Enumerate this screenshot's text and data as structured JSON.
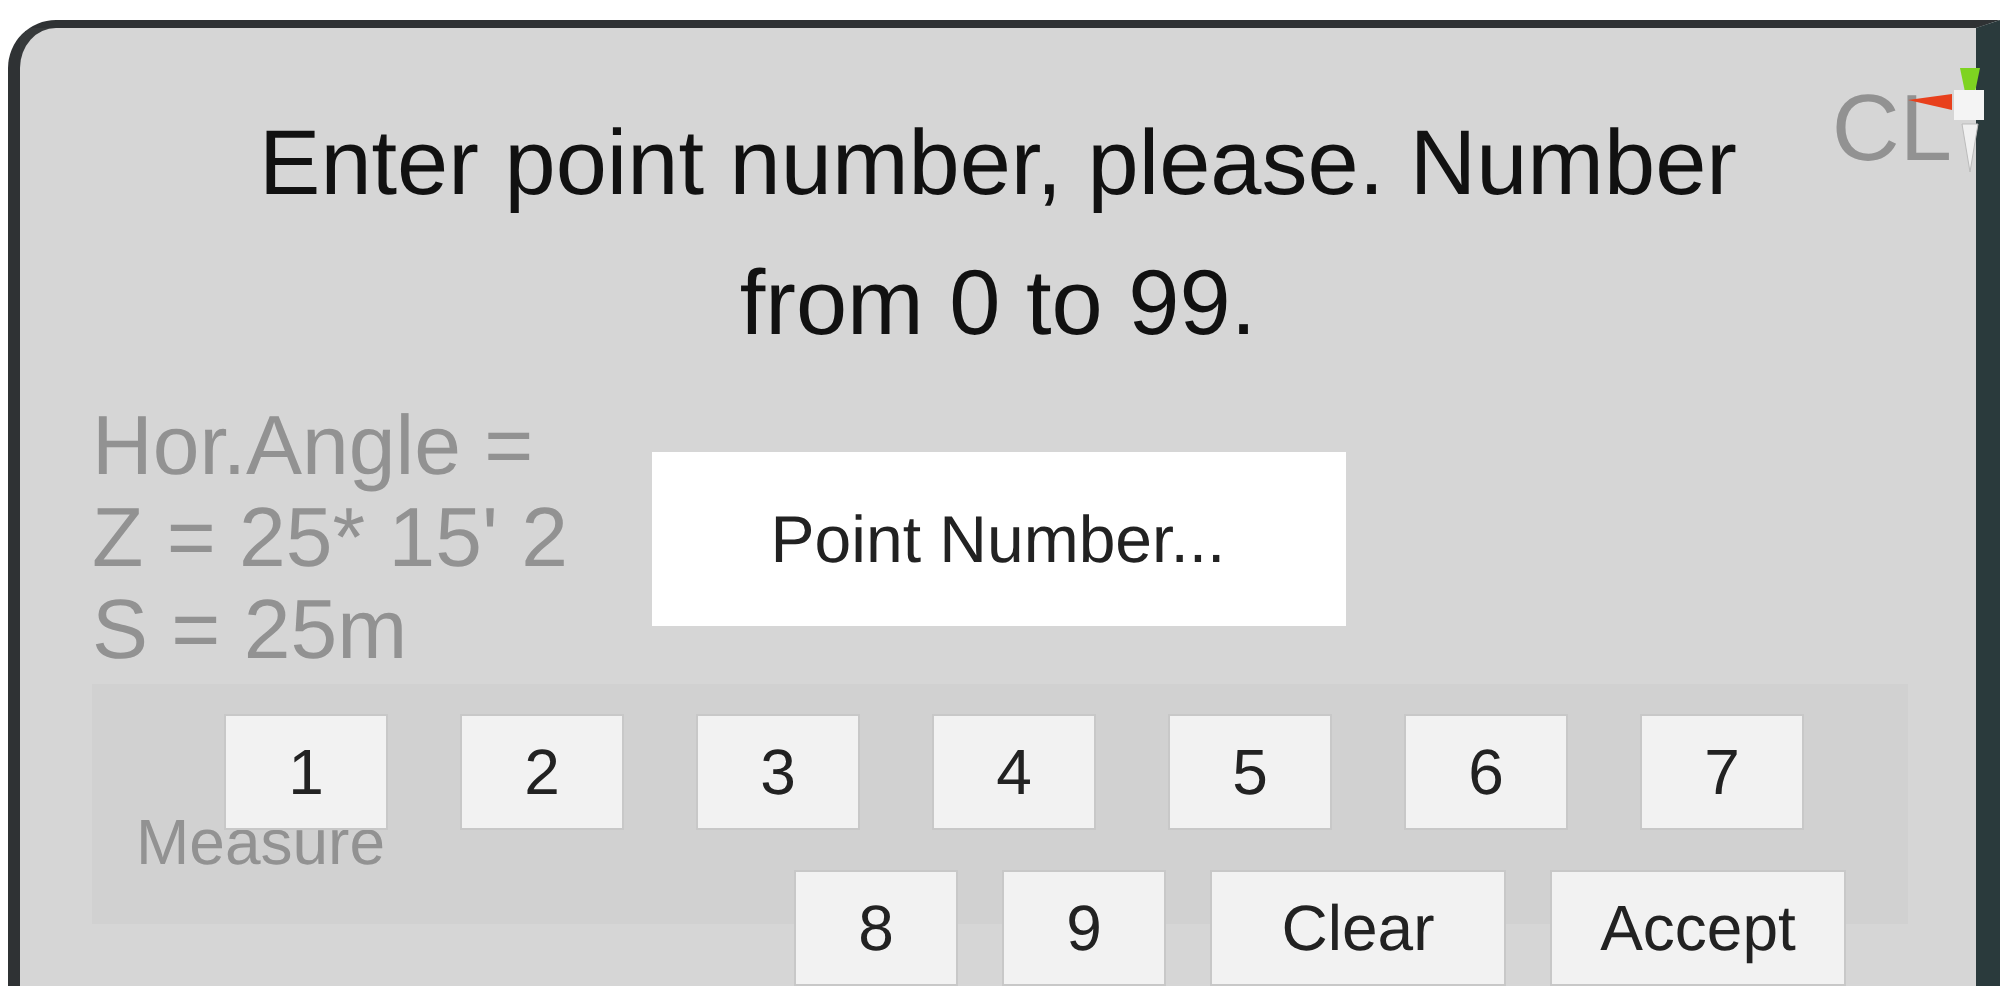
{
  "background_readings": [
    "Hor.Angle =",
    "Z = 25* 15' 2",
    "S = 25m"
  ],
  "background_corner_label": "CL",
  "background_buttons": [
    "Measure"
  ],
  "prompt": "Enter point number, please. Number from 0 to 99.",
  "input": {
    "placeholder": "Point Number..."
  },
  "keypad": [
    [
      "1",
      "2",
      "3",
      "4",
      "5",
      "6",
      "7"
    ],
    [
      "8",
      "9",
      "Clear",
      "Accept"
    ]
  ]
}
